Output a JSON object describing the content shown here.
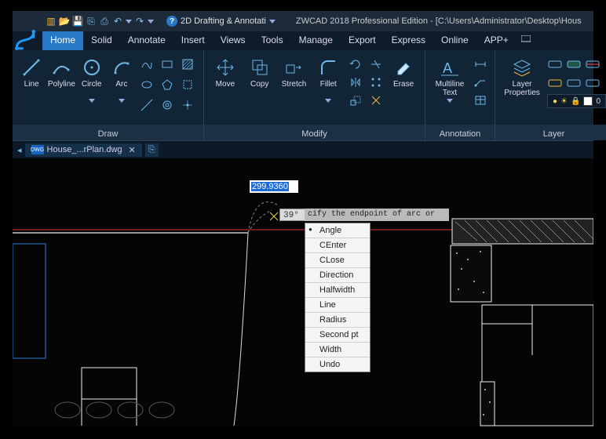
{
  "workspace": {
    "label": "2D Drafting & Annotati"
  },
  "title": "ZWCAD 2018 Professional Edition - [C:\\Users\\Administrator\\Desktop\\Hous",
  "tabs": [
    "Home",
    "Solid",
    "Annotate",
    "Insert",
    "Views",
    "Tools",
    "Manage",
    "Export",
    "Express",
    "Online",
    "APP+"
  ],
  "active_tab": "Home",
  "panels": {
    "draw": {
      "title": "Draw",
      "buttons": [
        {
          "label": "Line"
        },
        {
          "label": "Polyline"
        },
        {
          "label": "Circle",
          "dd": true
        },
        {
          "label": "Arc",
          "dd": true
        }
      ]
    },
    "modify": {
      "title": "Modify",
      "buttons": [
        {
          "label": "Move"
        },
        {
          "label": "Copy"
        },
        {
          "label": "Stretch"
        },
        {
          "label": "Fillet",
          "dd": true
        },
        {
          "label": "Erase"
        }
      ]
    },
    "annotation": {
      "title": "Annotation",
      "buttons": [
        {
          "label": "Multiline\nText",
          "dd": true
        }
      ]
    },
    "layer": {
      "title": "Layer",
      "buttons": [
        {
          "label": "Layer\nProperties"
        }
      ],
      "current": "0"
    }
  },
  "document": {
    "name": "House_...rPlan.dwg"
  },
  "dynamic_input": {
    "distance": "299.9360",
    "angle": "39°"
  },
  "prompt": "cify the endpoint of arc or",
  "context_menu": [
    "Angle",
    "CEnter",
    "CLose",
    "Direction",
    "Halfwidth",
    "Line",
    "Radius",
    "Second pt",
    "Width",
    "Undo"
  ]
}
